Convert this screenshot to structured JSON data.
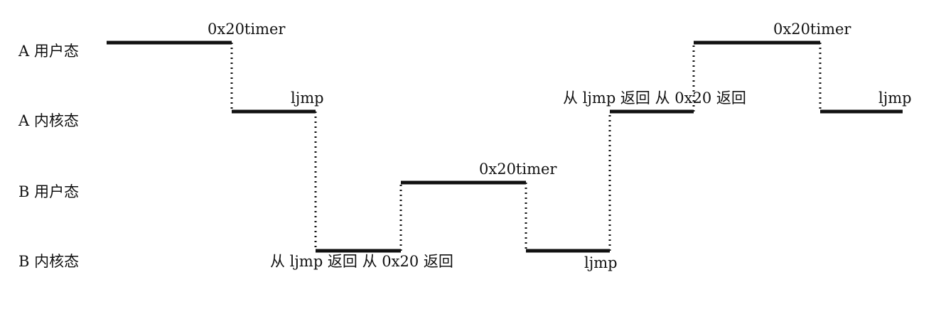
{
  "rows": [
    {
      "id": "a-user",
      "label": "A 用户态"
    },
    {
      "id": "a-kernel",
      "label": "A 内核态"
    },
    {
      "id": "b-user",
      "label": "B 用户态"
    },
    {
      "id": "b-kernel",
      "label": "B 内核态"
    }
  ],
  "segments": [
    {
      "row": 0,
      "start": 0,
      "end": 1
    },
    {
      "row": 1,
      "start": 1,
      "end": 2
    },
    {
      "row": 3,
      "start": 2,
      "end": 3
    },
    {
      "row": 2,
      "start": 3,
      "end": 4
    },
    {
      "row": 3,
      "start": 4,
      "end": 5
    },
    {
      "row": 1,
      "start": 5,
      "end": 6
    },
    {
      "row": 0,
      "start": 6,
      "end": 7
    },
    {
      "row": 1,
      "start": 7,
      "end": 8
    }
  ],
  "annotations": [
    {
      "text": "0x20timer"
    },
    {
      "text": "ljmp"
    },
    {
      "text": "从 ljmp 返回 从 0x20 返回"
    },
    {
      "text": "0x20timer"
    },
    {
      "text": "ljmp"
    },
    {
      "text": "从 ljmp 返回 从 0x20 返回"
    },
    {
      "text": "0x20timer"
    },
    {
      "text": "ljmp"
    }
  ],
  "colors": {
    "line": "#111111",
    "text": "#111111"
  }
}
